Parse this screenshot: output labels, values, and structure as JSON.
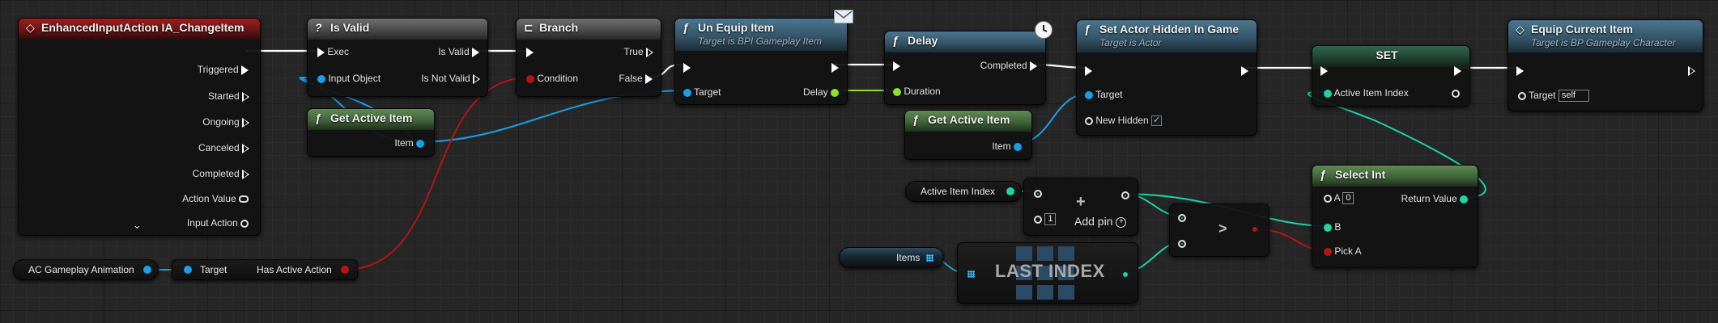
{
  "nodes": {
    "event": {
      "title": "EnhancedInputAction IA_ChangeItem",
      "pins": [
        "Triggered",
        "Started",
        "Ongoing",
        "Canceled",
        "Completed",
        "Action Value",
        "Input Action"
      ]
    },
    "is_valid": {
      "title": "Is Valid",
      "exec": "Exec",
      "input_object": "Input Object",
      "is_valid": "Is Valid",
      "is_not_valid": "Is Not Valid"
    },
    "get_active_item_1": {
      "title": "Get Active Item",
      "item": "Item"
    },
    "branch": {
      "title": "Branch",
      "condition": "Condition",
      "true": "True",
      "false": "False"
    },
    "unequip": {
      "title": "Un Equip Item",
      "subtitle": "Target is BPI Gameplay Item",
      "target": "Target",
      "delay": "Delay"
    },
    "delay": {
      "title": "Delay",
      "completed": "Completed",
      "duration": "Duration"
    },
    "set_hidden": {
      "title": "Set Actor Hidden In Game",
      "subtitle": "Target is Actor",
      "target": "Target",
      "new_hidden": "New Hidden",
      "new_hidden_checked": "✓"
    },
    "get_active_item_2": {
      "title": "Get Active Item",
      "item": "Item"
    },
    "set": {
      "title": "SET",
      "active_item_index": "Active Item Index"
    },
    "equip": {
      "title": "Equip Current Item",
      "subtitle": "Target is BP Gameplay Character",
      "target": "Target",
      "target_value": "self"
    },
    "select_int": {
      "title": "Select Int",
      "a": "A",
      "a_value": "0",
      "b": "B",
      "pick_a": "Pick A",
      "return_value": "Return Value"
    },
    "add": {
      "value": "1",
      "add_pin": "Add pin",
      "plus": "+"
    },
    "greater": {
      "op": ">"
    },
    "last_index": {
      "title": "LAST INDEX"
    },
    "ac_anim": {
      "label": "AC Gameplay Animation"
    },
    "has_active_action": {
      "target": "Target",
      "output": "Has Active Action"
    },
    "active_item_index_var": {
      "label": "Active Item Index"
    },
    "items_var": {
      "label": "Items"
    }
  },
  "colors": {
    "exec": "#ffffff",
    "object": "#1b9ee8",
    "bool": "#b81414",
    "float": "#8fe02c",
    "int": "#1fd3a6",
    "event_header": "#9b1f1f",
    "function_header": "#4d7591",
    "pure_header": "#5f8a53"
  }
}
